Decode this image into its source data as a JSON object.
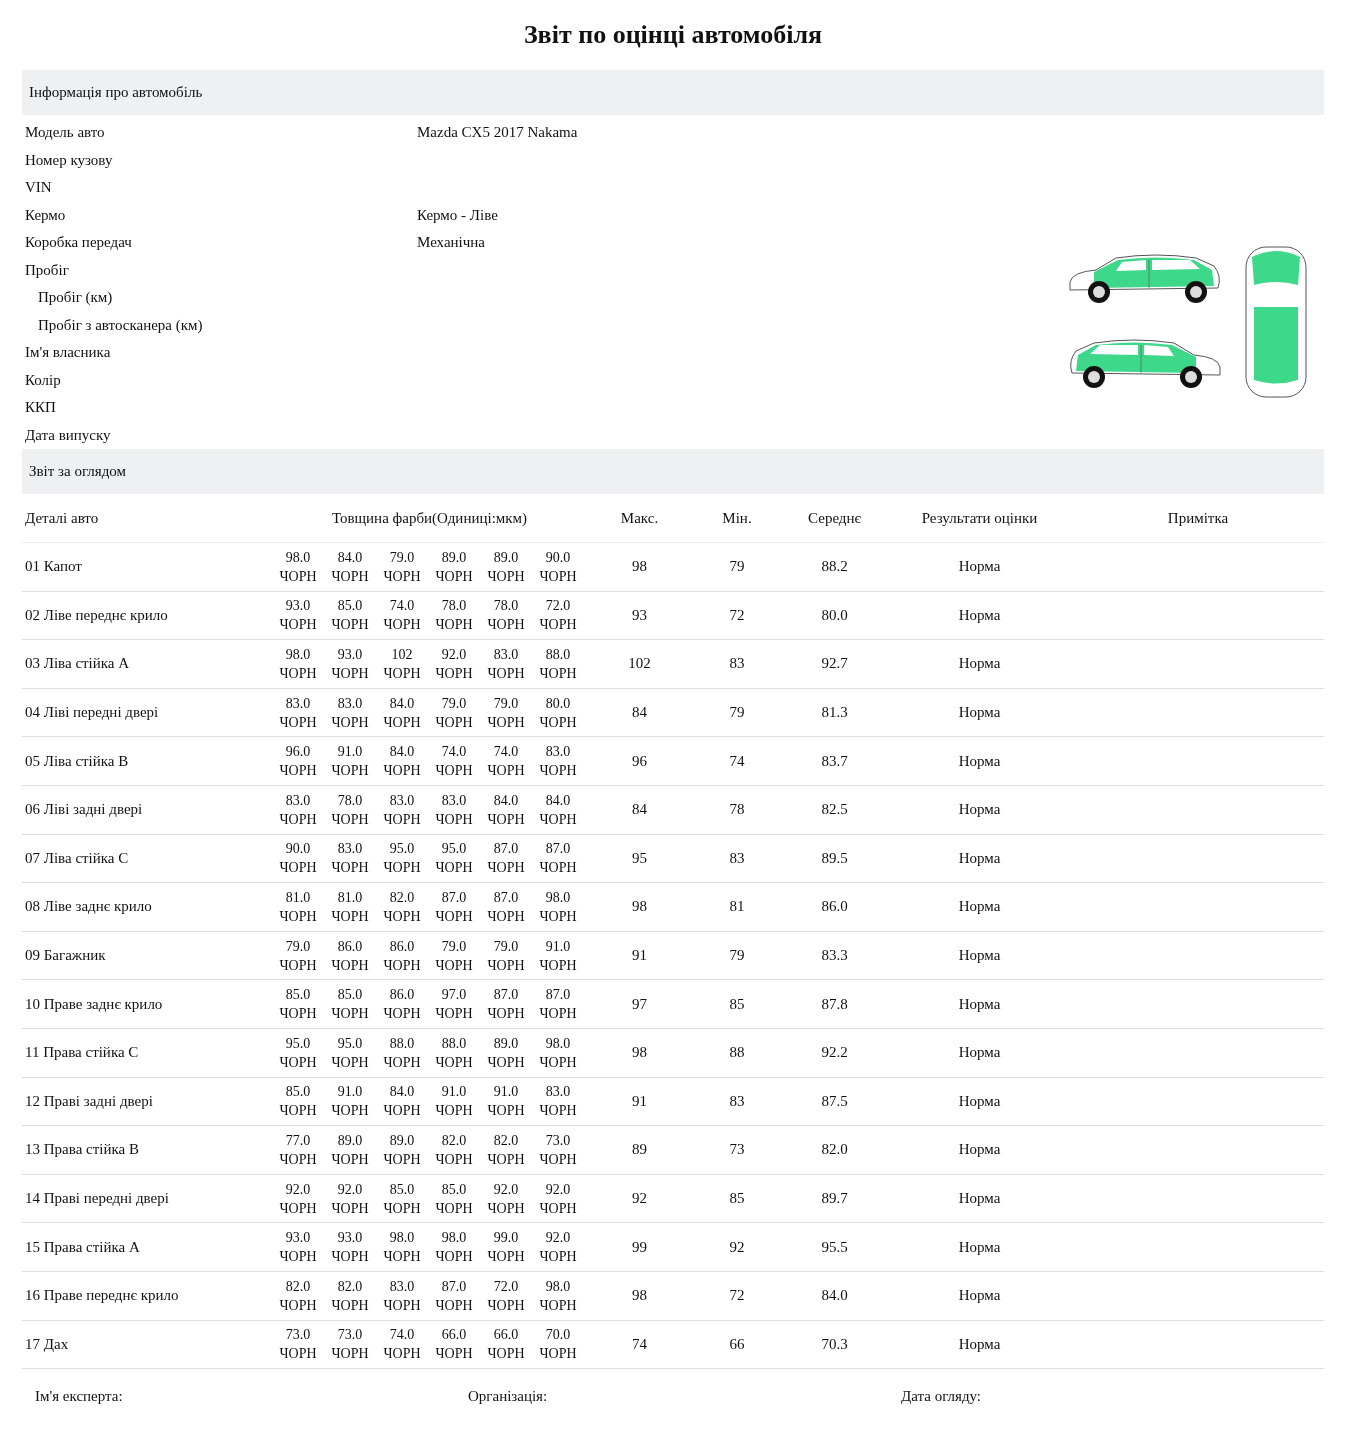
{
  "title": "Звіт по оцінці автомобіля",
  "car_info": {
    "heading": "Інформація про автомобіль",
    "fields": [
      {
        "label": "Модель авто",
        "value": "Mazda CX5  2017 Nakama"
      },
      {
        "label": "Номер кузову"
      },
      {
        "label": "VIN"
      },
      {
        "label": "Кермо",
        "value": "Кермо - Ліве"
      },
      {
        "label": "Коробка передач",
        "value": "Механічна"
      },
      {
        "label": "Пробіг",
        "children": [
          {
            "label": "Пробіг (км)"
          },
          {
            "label": "Пробіг з автосканера (км)"
          }
        ]
      },
      {
        "label": "Ім'я власника"
      },
      {
        "label": "Колір"
      },
      {
        "label": "ККП"
      },
      {
        "label": "Дата випуску"
      }
    ]
  },
  "inspection": {
    "heading": "Звіт за оглядом",
    "columns": [
      "Деталі авто",
      "Товщина фарби(Одиниці:мкм)",
      "Макс.",
      "Мін.",
      "Середнє",
      "Результати оцінки",
      "Примітка"
    ],
    "rows": [
      {
        "number": "01",
        "part": "Капот",
        "readings": [
          {
            "value": "98.0",
            "paint": "ЧОРН"
          },
          {
            "value": "84.0",
            "paint": "ЧОРН"
          },
          {
            "value": "79.0",
            "paint": "ЧОРН"
          },
          {
            "value": "89.0",
            "paint": "ЧОРН"
          },
          {
            "value": "89.0",
            "paint": "ЧОРН"
          },
          {
            "value": "90.0",
            "paint": "ЧОРН"
          }
        ],
        "max": "98",
        "min": "79",
        "avg": "88.2",
        "result": "Норма"
      },
      {
        "number": "02",
        "part": "Ліве переднє крило",
        "readings": [
          {
            "value": "93.0",
            "paint": "ЧОРН"
          },
          {
            "value": "85.0",
            "paint": "ЧОРН"
          },
          {
            "value": "74.0",
            "paint": "ЧОРН"
          },
          {
            "value": "78.0",
            "paint": "ЧОРН"
          },
          {
            "value": "78.0",
            "paint": "ЧОРН"
          },
          {
            "value": "72.0",
            "paint": "ЧОРН"
          }
        ],
        "max": "93",
        "min": "72",
        "avg": "80.0",
        "result": "Норма"
      },
      {
        "number": "03",
        "part": "Ліва стійка A",
        "readings": [
          {
            "value": "98.0",
            "paint": "ЧОРН"
          },
          {
            "value": "93.0",
            "paint": "ЧОРН"
          },
          {
            "value": "102",
            "paint": "ЧОРН"
          },
          {
            "value": "92.0",
            "paint": "ЧОРН"
          },
          {
            "value": "83.0",
            "paint": "ЧОРН"
          },
          {
            "value": "88.0",
            "paint": "ЧОРН"
          }
        ],
        "max": "102",
        "min": "83",
        "avg": "92.7",
        "result": "Норма"
      },
      {
        "number": "04",
        "part": "Ліві передні двері",
        "readings": [
          {
            "value": "83.0",
            "paint": "ЧОРН"
          },
          {
            "value": "83.0",
            "paint": "ЧОРН"
          },
          {
            "value": "84.0",
            "paint": "ЧОРН"
          },
          {
            "value": "79.0",
            "paint": "ЧОРН"
          },
          {
            "value": "79.0",
            "paint": "ЧОРН"
          },
          {
            "value": "80.0",
            "paint": "ЧОРН"
          }
        ],
        "max": "84",
        "min": "79",
        "avg": "81.3",
        "result": "Норма"
      },
      {
        "number": "05",
        "part": "Ліва стійка B",
        "readings": [
          {
            "value": "96.0",
            "paint": "ЧОРН"
          },
          {
            "value": "91.0",
            "paint": "ЧОРН"
          },
          {
            "value": "84.0",
            "paint": "ЧОРН"
          },
          {
            "value": "74.0",
            "paint": "ЧОРН"
          },
          {
            "value": "74.0",
            "paint": "ЧОРН"
          },
          {
            "value": "83.0",
            "paint": "ЧОРН"
          }
        ],
        "max": "96",
        "min": "74",
        "avg": "83.7",
        "result": "Норма"
      },
      {
        "number": "06",
        "part": "Ліві задні двері",
        "readings": [
          {
            "value": "83.0",
            "paint": "ЧОРН"
          },
          {
            "value": "78.0",
            "paint": "ЧОРН"
          },
          {
            "value": "83.0",
            "paint": "ЧОРН"
          },
          {
            "value": "83.0",
            "paint": "ЧОРН"
          },
          {
            "value": "84.0",
            "paint": "ЧОРН"
          },
          {
            "value": "84.0",
            "paint": "ЧОРН"
          }
        ],
        "max": "84",
        "min": "78",
        "avg": "82.5",
        "result": "Норма"
      },
      {
        "number": "07",
        "part": "Ліва стійка C",
        "readings": [
          {
            "value": "90.0",
            "paint": "ЧОРН"
          },
          {
            "value": "83.0",
            "paint": "ЧОРН"
          },
          {
            "value": "95.0",
            "paint": "ЧОРН"
          },
          {
            "value": "95.0",
            "paint": "ЧОРН"
          },
          {
            "value": "87.0",
            "paint": "ЧОРН"
          },
          {
            "value": "87.0",
            "paint": "ЧОРН"
          }
        ],
        "max": "95",
        "min": "83",
        "avg": "89.5",
        "result": "Норма"
      },
      {
        "number": "08",
        "part": "Ліве заднє крило",
        "readings": [
          {
            "value": "81.0",
            "paint": "ЧОРН"
          },
          {
            "value": "81.0",
            "paint": "ЧОРН"
          },
          {
            "value": "82.0",
            "paint": "ЧОРН"
          },
          {
            "value": "87.0",
            "paint": "ЧОРН"
          },
          {
            "value": "87.0",
            "paint": "ЧОРН"
          },
          {
            "value": "98.0",
            "paint": "ЧОРН"
          }
        ],
        "max": "98",
        "min": "81",
        "avg": "86.0",
        "result": "Норма"
      },
      {
        "number": "09",
        "part": "Багажник",
        "readings": [
          {
            "value": "79.0",
            "paint": "ЧОРН"
          },
          {
            "value": "86.0",
            "paint": "ЧОРН"
          },
          {
            "value": "86.0",
            "paint": "ЧОРН"
          },
          {
            "value": "79.0",
            "paint": "ЧОРН"
          },
          {
            "value": "79.0",
            "paint": "ЧОРН"
          },
          {
            "value": "91.0",
            "paint": "ЧОРН"
          }
        ],
        "max": "91",
        "min": "79",
        "avg": "83.3",
        "result": "Норма"
      },
      {
        "number": "10",
        "part": "Праве заднє крило",
        "readings": [
          {
            "value": "85.0",
            "paint": "ЧОРН"
          },
          {
            "value": "85.0",
            "paint": "ЧОРН"
          },
          {
            "value": "86.0",
            "paint": "ЧОРН"
          },
          {
            "value": "97.0",
            "paint": "ЧОРН"
          },
          {
            "value": "87.0",
            "paint": "ЧОРН"
          },
          {
            "value": "87.0",
            "paint": "ЧОРН"
          }
        ],
        "max": "97",
        "min": "85",
        "avg": "87.8",
        "result": "Норма"
      },
      {
        "number": "11",
        "part": "Права стійка C",
        "readings": [
          {
            "value": "95.0",
            "paint": "ЧОРН"
          },
          {
            "value": "95.0",
            "paint": "ЧОРН"
          },
          {
            "value": "88.0",
            "paint": "ЧОРН"
          },
          {
            "value": "88.0",
            "paint": "ЧОРН"
          },
          {
            "value": "89.0",
            "paint": "ЧОРН"
          },
          {
            "value": "98.0",
            "paint": "ЧОРН"
          }
        ],
        "max": "98",
        "min": "88",
        "avg": "92.2",
        "result": "Норма"
      },
      {
        "number": "12",
        "part": "Праві задні двері",
        "readings": [
          {
            "value": "85.0",
            "paint": "ЧОРН"
          },
          {
            "value": "91.0",
            "paint": "ЧОРН"
          },
          {
            "value": "84.0",
            "paint": "ЧОРН"
          },
          {
            "value": "91.0",
            "paint": "ЧОРН"
          },
          {
            "value": "91.0",
            "paint": "ЧОРН"
          },
          {
            "value": "83.0",
            "paint": "ЧОРН"
          }
        ],
        "max": "91",
        "min": "83",
        "avg": "87.5",
        "result": "Норма"
      },
      {
        "number": "13",
        "part": "Права стійка B",
        "readings": [
          {
            "value": "77.0",
            "paint": "ЧОРН"
          },
          {
            "value": "89.0",
            "paint": "ЧОРН"
          },
          {
            "value": "89.0",
            "paint": "ЧОРН"
          },
          {
            "value": "82.0",
            "paint": "ЧОРН"
          },
          {
            "value": "82.0",
            "paint": "ЧОРН"
          },
          {
            "value": "73.0",
            "paint": "ЧОРН"
          }
        ],
        "max": "89",
        "min": "73",
        "avg": "82.0",
        "result": "Норма"
      },
      {
        "number": "14",
        "part": "Праві передні двері",
        "readings": [
          {
            "value": "92.0",
            "paint": "ЧОРН"
          },
          {
            "value": "92.0",
            "paint": "ЧОРН"
          },
          {
            "value": "85.0",
            "paint": "ЧОРН"
          },
          {
            "value": "85.0",
            "paint": "ЧОРН"
          },
          {
            "value": "92.0",
            "paint": "ЧОРН"
          },
          {
            "value": "92.0",
            "paint": "ЧОРН"
          }
        ],
        "max": "92",
        "min": "85",
        "avg": "89.7",
        "result": "Норма"
      },
      {
        "number": "15",
        "part": "Права стійка A",
        "readings": [
          {
            "value": "93.0",
            "paint": "ЧОРН"
          },
          {
            "value": "93.0",
            "paint": "ЧОРН"
          },
          {
            "value": "98.0",
            "paint": "ЧОРН"
          },
          {
            "value": "98.0",
            "paint": "ЧОРН"
          },
          {
            "value": "99.0",
            "paint": "ЧОРН"
          },
          {
            "value": "92.0",
            "paint": "ЧОРН"
          }
        ],
        "max": "99",
        "min": "92",
        "avg": "95.5",
        "result": "Норма"
      },
      {
        "number": "16",
        "part": "Праве переднє крило",
        "readings": [
          {
            "value": "82.0",
            "paint": "ЧОРН"
          },
          {
            "value": "82.0",
            "paint": "ЧОРН"
          },
          {
            "value": "83.0",
            "paint": "ЧОРН"
          },
          {
            "value": "87.0",
            "paint": "ЧОРН"
          },
          {
            "value": "72.0",
            "paint": "ЧОРН"
          },
          {
            "value": "98.0",
            "paint": "ЧОРН"
          }
        ],
        "max": "98",
        "min": "72",
        "avg": "84.0",
        "result": "Норма"
      },
      {
        "number": "17",
        "part": "Дах",
        "readings": [
          {
            "value": "73.0",
            "paint": "ЧОРН"
          },
          {
            "value": "73.0",
            "paint": "ЧОРН"
          },
          {
            "value": "74.0",
            "paint": "ЧОРН"
          },
          {
            "value": "66.0",
            "paint": "ЧОРН"
          },
          {
            "value": "66.0",
            "paint": "ЧОРН"
          },
          {
            "value": "70.0",
            "paint": "ЧОРН"
          }
        ],
        "max": "74",
        "min": "66",
        "avg": "70.3",
        "result": "Норма"
      }
    ]
  },
  "footer": [
    "Ім'я експерта:",
    "Організація:",
    "Дата огляду:"
  ]
}
